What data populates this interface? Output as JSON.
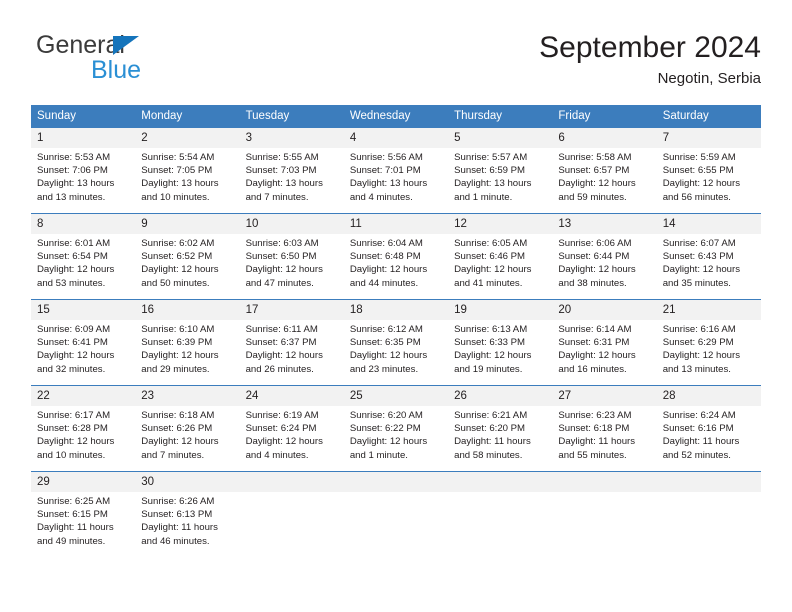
{
  "logo": {
    "word_one": "General",
    "word_two": "Blue",
    "triangle_color": "#1574bb",
    "word_two_color": "#2a8fd4"
  },
  "header": {
    "title": "September 2024",
    "subtitle": "Negotin, Serbia",
    "accent_color": "#3c7dbd"
  },
  "weekdays": [
    "Sunday",
    "Monday",
    "Tuesday",
    "Wednesday",
    "Thursday",
    "Friday",
    "Saturday"
  ],
  "weeks": [
    [
      {
        "day": "1",
        "lines": [
          "Sunrise: 5:53 AM",
          "Sunset: 7:06 PM",
          "Daylight: 13 hours",
          "and 13 minutes."
        ]
      },
      {
        "day": "2",
        "lines": [
          "Sunrise: 5:54 AM",
          "Sunset: 7:05 PM",
          "Daylight: 13 hours",
          "and 10 minutes."
        ]
      },
      {
        "day": "3",
        "lines": [
          "Sunrise: 5:55 AM",
          "Sunset: 7:03 PM",
          "Daylight: 13 hours",
          "and 7 minutes."
        ]
      },
      {
        "day": "4",
        "lines": [
          "Sunrise: 5:56 AM",
          "Sunset: 7:01 PM",
          "Daylight: 13 hours",
          "and 4 minutes."
        ]
      },
      {
        "day": "5",
        "lines": [
          "Sunrise: 5:57 AM",
          "Sunset: 6:59 PM",
          "Daylight: 13 hours",
          "and 1 minute."
        ]
      },
      {
        "day": "6",
        "lines": [
          "Sunrise: 5:58 AM",
          "Sunset: 6:57 PM",
          "Daylight: 12 hours",
          "and 59 minutes."
        ]
      },
      {
        "day": "7",
        "lines": [
          "Sunrise: 5:59 AM",
          "Sunset: 6:55 PM",
          "Daylight: 12 hours",
          "and 56 minutes."
        ]
      }
    ],
    [
      {
        "day": "8",
        "lines": [
          "Sunrise: 6:01 AM",
          "Sunset: 6:54 PM",
          "Daylight: 12 hours",
          "and 53 minutes."
        ]
      },
      {
        "day": "9",
        "lines": [
          "Sunrise: 6:02 AM",
          "Sunset: 6:52 PM",
          "Daylight: 12 hours",
          "and 50 minutes."
        ]
      },
      {
        "day": "10",
        "lines": [
          "Sunrise: 6:03 AM",
          "Sunset: 6:50 PM",
          "Daylight: 12 hours",
          "and 47 minutes."
        ]
      },
      {
        "day": "11",
        "lines": [
          "Sunrise: 6:04 AM",
          "Sunset: 6:48 PM",
          "Daylight: 12 hours",
          "and 44 minutes."
        ]
      },
      {
        "day": "12",
        "lines": [
          "Sunrise: 6:05 AM",
          "Sunset: 6:46 PM",
          "Daylight: 12 hours",
          "and 41 minutes."
        ]
      },
      {
        "day": "13",
        "lines": [
          "Sunrise: 6:06 AM",
          "Sunset: 6:44 PM",
          "Daylight: 12 hours",
          "and 38 minutes."
        ]
      },
      {
        "day": "14",
        "lines": [
          "Sunrise: 6:07 AM",
          "Sunset: 6:43 PM",
          "Daylight: 12 hours",
          "and 35 minutes."
        ]
      }
    ],
    [
      {
        "day": "15",
        "lines": [
          "Sunrise: 6:09 AM",
          "Sunset: 6:41 PM",
          "Daylight: 12 hours",
          "and 32 minutes."
        ]
      },
      {
        "day": "16",
        "lines": [
          "Sunrise: 6:10 AM",
          "Sunset: 6:39 PM",
          "Daylight: 12 hours",
          "and 29 minutes."
        ]
      },
      {
        "day": "17",
        "lines": [
          "Sunrise: 6:11 AM",
          "Sunset: 6:37 PM",
          "Daylight: 12 hours",
          "and 26 minutes."
        ]
      },
      {
        "day": "18",
        "lines": [
          "Sunrise: 6:12 AM",
          "Sunset: 6:35 PM",
          "Daylight: 12 hours",
          "and 23 minutes."
        ]
      },
      {
        "day": "19",
        "lines": [
          "Sunrise: 6:13 AM",
          "Sunset: 6:33 PM",
          "Daylight: 12 hours",
          "and 19 minutes."
        ]
      },
      {
        "day": "20",
        "lines": [
          "Sunrise: 6:14 AM",
          "Sunset: 6:31 PM",
          "Daylight: 12 hours",
          "and 16 minutes."
        ]
      },
      {
        "day": "21",
        "lines": [
          "Sunrise: 6:16 AM",
          "Sunset: 6:29 PM",
          "Daylight: 12 hours",
          "and 13 minutes."
        ]
      }
    ],
    [
      {
        "day": "22",
        "lines": [
          "Sunrise: 6:17 AM",
          "Sunset: 6:28 PM",
          "Daylight: 12 hours",
          "and 10 minutes."
        ]
      },
      {
        "day": "23",
        "lines": [
          "Sunrise: 6:18 AM",
          "Sunset: 6:26 PM",
          "Daylight: 12 hours",
          "and 7 minutes."
        ]
      },
      {
        "day": "24",
        "lines": [
          "Sunrise: 6:19 AM",
          "Sunset: 6:24 PM",
          "Daylight: 12 hours",
          "and 4 minutes."
        ]
      },
      {
        "day": "25",
        "lines": [
          "Sunrise: 6:20 AM",
          "Sunset: 6:22 PM",
          "Daylight: 12 hours",
          "and 1 minute."
        ]
      },
      {
        "day": "26",
        "lines": [
          "Sunrise: 6:21 AM",
          "Sunset: 6:20 PM",
          "Daylight: 11 hours",
          "and 58 minutes."
        ]
      },
      {
        "day": "27",
        "lines": [
          "Sunrise: 6:23 AM",
          "Sunset: 6:18 PM",
          "Daylight: 11 hours",
          "and 55 minutes."
        ]
      },
      {
        "day": "28",
        "lines": [
          "Sunrise: 6:24 AM",
          "Sunset: 6:16 PM",
          "Daylight: 11 hours",
          "and 52 minutes."
        ]
      }
    ],
    [
      {
        "day": "29",
        "lines": [
          "Sunrise: 6:25 AM",
          "Sunset: 6:15 PM",
          "Daylight: 11 hours",
          "and 49 minutes."
        ]
      },
      {
        "day": "30",
        "lines": [
          "Sunrise: 6:26 AM",
          "Sunset: 6:13 PM",
          "Daylight: 11 hours",
          "and 46 minutes."
        ]
      },
      {
        "day": "",
        "lines": []
      },
      {
        "day": "",
        "lines": []
      },
      {
        "day": "",
        "lines": []
      },
      {
        "day": "",
        "lines": []
      },
      {
        "day": "",
        "lines": []
      }
    ]
  ]
}
